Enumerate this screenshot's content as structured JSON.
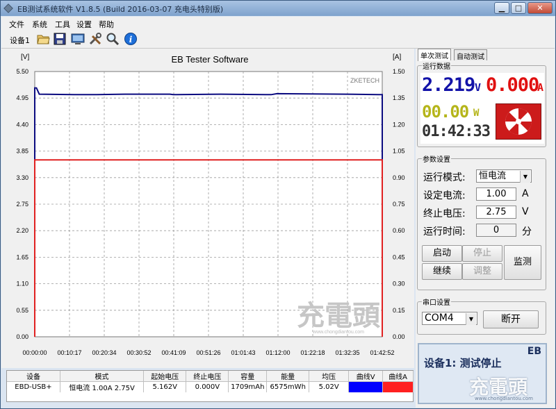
{
  "window": {
    "title": "EB测试系统软件 V1.8.5 (Build 2016-03-07 充电头特别版)",
    "min_label": "▁",
    "max_label": "□",
    "close_label": "✕"
  },
  "menu": {
    "items": [
      "文件",
      "系统",
      "工具",
      "设置",
      "帮助"
    ]
  },
  "toolbar": {
    "device_label": "设备1",
    "icons": [
      "open-folder-icon",
      "save-disk-icon",
      "monitor-icon",
      "tools-icon",
      "search-icon",
      "info-icon"
    ]
  },
  "chart": {
    "title": "EB Tester Software",
    "left_unit": "[V]",
    "right_unit": "[A]",
    "brand": "ZKETECH",
    "watermark": "充電頭",
    "watermark_sub": "www.chongdiantou.com"
  },
  "chart_data": {
    "type": "line",
    "title": "EB Tester Software",
    "xlabel": "",
    "ylabel": "[V]",
    "y2label": "[A]",
    "x_ticks": [
      "00:00:00",
      "00:10:17",
      "00:20:34",
      "00:30:52",
      "00:41:09",
      "00:51:26",
      "01:01:43",
      "01:12:00",
      "01:22:18",
      "01:32:35",
      "01:42:52"
    ],
    "y_ticks": [
      "0.00",
      "0.55",
      "1.10",
      "1.65",
      "2.20",
      "2.75",
      "3.30",
      "3.85",
      "4.40",
      "4.95",
      "5.50"
    ],
    "y2_ticks": [
      "0.00",
      "0.15",
      "0.30",
      "0.45",
      "0.60",
      "0.75",
      "0.90",
      "1.05",
      "1.20",
      "1.35",
      "1.50"
    ],
    "ylim": [
      0,
      5.5
    ],
    "y2lim": [
      0,
      1.5
    ],
    "xlim_seconds": [
      0,
      6172
    ],
    "grid": true,
    "series": [
      {
        "name": "曲线V",
        "color": "#0b0b80",
        "axis": "left",
        "points": [
          [
            0,
            0
          ],
          [
            0,
            5.16
          ],
          [
            30,
            5.16
          ],
          [
            80,
            5.03
          ],
          [
            700,
            5.02
          ],
          [
            1100,
            5.02
          ],
          [
            1600,
            5.03
          ],
          [
            2400,
            5.03
          ],
          [
            2460,
            5.02
          ],
          [
            3300,
            5.03
          ],
          [
            4200,
            5.02
          ],
          [
            4300,
            5.04
          ],
          [
            5500,
            5.03
          ],
          [
            6100,
            5.02
          ],
          [
            6172,
            5.02
          ],
          [
            6172,
            0
          ]
        ]
      },
      {
        "name": "曲线A",
        "color": "#e02020",
        "axis": "right",
        "points": [
          [
            0,
            0
          ],
          [
            0,
            1.0
          ],
          [
            6172,
            1.0
          ],
          [
            6172,
            0
          ]
        ]
      }
    ]
  },
  "right_panel": {
    "tabs": [
      "单次测试",
      "自动测试"
    ],
    "run_data": {
      "label": "运行数据",
      "voltage": "2.219",
      "voltage_unit": "V",
      "current": "0.000",
      "current_unit": "A",
      "power": "00.00",
      "power_unit": "W",
      "time": "01:42:33"
    },
    "params": {
      "label": "参数设置",
      "mode_label": "运行模式:",
      "mode_value": "恒电流",
      "set_current_label": "设定电流:",
      "set_current_value": "1.00",
      "set_current_unit": "A",
      "end_voltage_label": "终止电压:",
      "end_voltage_value": "2.75",
      "end_voltage_unit": "V",
      "run_time_label": "运行时间:",
      "run_time_value": "0",
      "run_time_unit": "分",
      "start_label": "启动",
      "stop_label": "停止",
      "continue_label": "继续",
      "adjust_label": "调整",
      "monitor_label": "监测"
    },
    "serial": {
      "label": "串口设置",
      "port": "COM4",
      "disconnect_label": "断开"
    },
    "status": {
      "corner": "EB",
      "text": "设备1: 测试停止"
    }
  },
  "table": {
    "headers": [
      "设备",
      "模式",
      "起始电压",
      "终止电压",
      "容量",
      "能量",
      "均压",
      "曲线V",
      "曲线A"
    ],
    "rows": [
      [
        "EBD-USB+",
        "恒电流 1.00A 2.75V",
        "5.162V",
        "0.000V",
        "1709mAh",
        "6575mWh",
        "5.02V",
        "",
        ""
      ]
    ]
  },
  "colors": {
    "voltage_digits": "#1212a8",
    "current_digits": "#e01010",
    "power_digits": "#b5b51a",
    "time_digits": "#333333",
    "curve_v": "#0000ff",
    "curve_a": "#ff2020"
  }
}
